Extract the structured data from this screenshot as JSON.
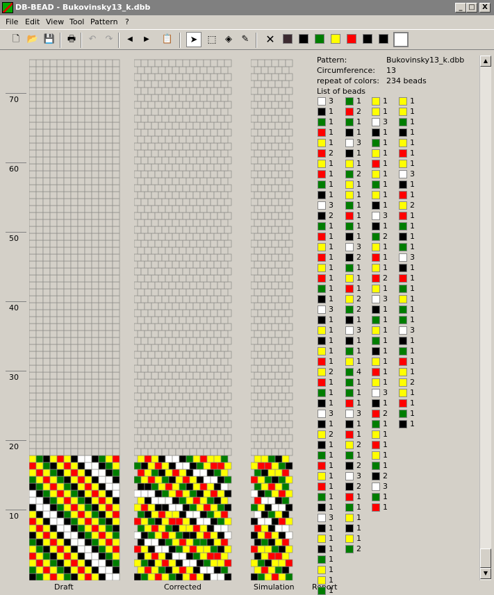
{
  "window": {
    "title": "DB-BEAD - Bukovinsky13_k.dbb",
    "minimize": "_",
    "maximize": "□",
    "close": "X"
  },
  "menu": [
    "File",
    "Edit",
    "View",
    "Tool",
    "Pattern",
    "?"
  ],
  "toolbar": {
    "swatches": [
      "#3c2a30",
      "#000000",
      "#007d00",
      "#ffff00",
      "#ff0000",
      "#000000",
      "#000000",
      "#ffffff"
    ]
  },
  "row_labels": [
    "70",
    "60",
    "50",
    "40",
    "30",
    "20",
    "10"
  ],
  "captions": {
    "draft": "Draft",
    "corrected": "Corrected",
    "simulation": "Simulation",
    "report": "Report"
  },
  "colors": {
    "0": "#ffffff",
    "1": "#000000",
    "2": "#007d00",
    "3": "#ffff00",
    "4": "#ff0000"
  },
  "report": {
    "pattern_label": "Pattern:",
    "pattern_value": "Bukovinsky13_k.dbb",
    "circ_label": "Circumference:",
    "circ_value": "13",
    "repeat_label": "repeat of colors:",
    "repeat_value": "234 beads",
    "list_label": "List of beads",
    "columns": [
      [
        [
          "0",
          "3"
        ],
        [
          "1",
          "1"
        ],
        [
          "2",
          "1"
        ],
        [
          "4",
          "1"
        ],
        [
          "3",
          "1"
        ],
        [
          "4",
          "2"
        ],
        [
          "3",
          "1"
        ],
        [
          "4",
          "1"
        ],
        [
          "2",
          "1"
        ],
        [
          "1",
          "1"
        ],
        [
          "0",
          "3"
        ],
        [
          "1",
          "2"
        ],
        [
          "2",
          "1"
        ],
        [
          "4",
          "1"
        ],
        [
          "3",
          "1"
        ],
        [
          "4",
          "1"
        ],
        [
          "3",
          "1"
        ],
        [
          "4",
          "1"
        ],
        [
          "2",
          "1"
        ],
        [
          "1",
          "1"
        ],
        [
          "0",
          "3"
        ],
        [
          "1",
          "1"
        ],
        [
          "3",
          "1"
        ],
        [
          "1",
          "1"
        ],
        [
          "3",
          "1"
        ],
        [
          "4",
          "1"
        ],
        [
          "3",
          "2"
        ],
        [
          "4",
          "1"
        ],
        [
          "2",
          "1"
        ],
        [
          "1",
          "1"
        ],
        [
          "0",
          "3"
        ],
        [
          "1",
          "1"
        ],
        [
          "3",
          "2"
        ],
        [
          "1",
          "1"
        ],
        [
          "2",
          "1"
        ],
        [
          "4",
          "1"
        ],
        [
          "3",
          "1"
        ],
        [
          "4",
          "1"
        ],
        [
          "2",
          "1"
        ],
        [
          "1",
          "1"
        ],
        [
          "0",
          "3"
        ],
        [
          "1",
          "1"
        ],
        [
          "3",
          "1"
        ],
        [
          "1",
          "1"
        ],
        [
          "2",
          "1"
        ],
        [
          "3",
          "1"
        ],
        [
          "3",
          "1"
        ],
        [
          "2",
          "1"
        ]
      ],
      [
        [
          "2",
          "1"
        ],
        [
          "4",
          "2"
        ],
        [
          "2",
          "1"
        ],
        [
          "1",
          "1"
        ],
        [
          "0",
          "3"
        ],
        [
          "1",
          "1"
        ],
        [
          "3",
          "1"
        ],
        [
          "2",
          "2"
        ],
        [
          "3",
          "1"
        ],
        [
          "3",
          "1"
        ],
        [
          "2",
          "1"
        ],
        [
          "4",
          "1"
        ],
        [
          "2",
          "1"
        ],
        [
          "1",
          "1"
        ],
        [
          "0",
          "3"
        ],
        [
          "1",
          "2"
        ],
        [
          "2",
          "1"
        ],
        [
          "3",
          "1"
        ],
        [
          "4",
          "1"
        ],
        [
          "3",
          "2"
        ],
        [
          "2",
          "2"
        ],
        [
          "1",
          "1"
        ],
        [
          "0",
          "3"
        ],
        [
          "1",
          "1"
        ],
        [
          "2",
          "1"
        ],
        [
          "3",
          "1"
        ],
        [
          "2",
          "4"
        ],
        [
          "2",
          "1"
        ],
        [
          "2",
          "1"
        ],
        [
          "4",
          "1"
        ],
        [
          "0",
          "3"
        ],
        [
          "1",
          "1"
        ],
        [
          "4",
          "1"
        ],
        [
          "3",
          "2"
        ],
        [
          "2",
          "1"
        ],
        [
          "1",
          "2"
        ],
        [
          "0",
          "3"
        ],
        [
          "1",
          "2"
        ],
        [
          "4",
          "1"
        ],
        [
          "2",
          "1"
        ],
        [
          "3",
          "1"
        ],
        [
          "1",
          "1"
        ],
        [
          "3",
          "1"
        ],
        [
          "2",
          "2"
        ]
      ],
      [
        [
          "3",
          "1"
        ],
        [
          "3",
          "1"
        ],
        [
          "0",
          "3"
        ],
        [
          "1",
          "1"
        ],
        [
          "2",
          "1"
        ],
        [
          "3",
          "1"
        ],
        [
          "4",
          "1"
        ],
        [
          "3",
          "1"
        ],
        [
          "2",
          "1"
        ],
        [
          "3",
          "1"
        ],
        [
          "1",
          "1"
        ],
        [
          "0",
          "3"
        ],
        [
          "1",
          "1"
        ],
        [
          "2",
          "2"
        ],
        [
          "3",
          "1"
        ],
        [
          "4",
          "1"
        ],
        [
          "3",
          "1"
        ],
        [
          "4",
          "2"
        ],
        [
          "3",
          "1"
        ],
        [
          "0",
          "3"
        ],
        [
          "1",
          "1"
        ],
        [
          "2",
          "1"
        ],
        [
          "3",
          "1"
        ],
        [
          "2",
          "1"
        ],
        [
          "1",
          "1"
        ],
        [
          "3",
          "1"
        ],
        [
          "4",
          "1"
        ],
        [
          "3",
          "1"
        ],
        [
          "0",
          "3"
        ],
        [
          "1",
          "1"
        ],
        [
          "4",
          "2"
        ],
        [
          "2",
          "1"
        ],
        [
          "3",
          "1"
        ],
        [
          "4",
          "1"
        ],
        [
          "3",
          "1"
        ],
        [
          "2",
          "1"
        ],
        [
          "1",
          "2"
        ],
        [
          "0",
          "3"
        ],
        [
          "2",
          "1"
        ],
        [
          "4",
          "1"
        ]
      ],
      [
        [
          "3",
          "1"
        ],
        [
          "3",
          "1"
        ],
        [
          "2",
          "1"
        ],
        [
          "1",
          "1"
        ],
        [
          "3",
          "1"
        ],
        [
          "4",
          "1"
        ],
        [
          "3",
          "1"
        ],
        [
          "0",
          "3"
        ],
        [
          "1",
          "1"
        ],
        [
          "4",
          "1"
        ],
        [
          "3",
          "2"
        ],
        [
          "4",
          "1"
        ],
        [
          "2",
          "1"
        ],
        [
          "1",
          "1"
        ],
        [
          "2",
          "1"
        ],
        [
          "0",
          "3"
        ],
        [
          "1",
          "1"
        ],
        [
          "4",
          "1"
        ],
        [
          "2",
          "1"
        ],
        [
          "3",
          "1"
        ],
        [
          "2",
          "1"
        ],
        [
          "2",
          "1"
        ],
        [
          "0",
          "3"
        ],
        [
          "1",
          "1"
        ],
        [
          "2",
          "1"
        ],
        [
          "4",
          "1"
        ],
        [
          "3",
          "1"
        ],
        [
          "3",
          "2"
        ],
        [
          "3",
          "1"
        ],
        [
          "4",
          "1"
        ],
        [
          "2",
          "1"
        ],
        [
          "1",
          "1"
        ]
      ]
    ]
  }
}
